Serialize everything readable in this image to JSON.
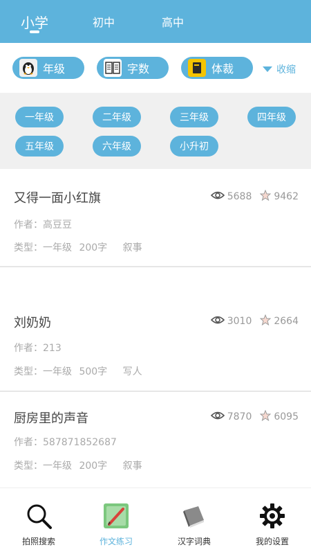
{
  "top_tabs": [
    {
      "label": "小学"
    },
    {
      "label": "初中"
    },
    {
      "label": "高中"
    }
  ],
  "filters": {
    "grade_label": "年级",
    "words_label": "字数",
    "style_label": "体裁",
    "collapse_label": "收缩"
  },
  "grades": [
    "一年级",
    "二年级",
    "三年级",
    "四年级",
    "五年级",
    "六年级",
    "小升初"
  ],
  "articles": [
    {
      "title": "又得一面小红旗",
      "views": "5688",
      "likes": "9462",
      "author": "作者：高豆豆",
      "type_prefix": "类型：一年级",
      "words": "200字",
      "genre": "叙事"
    },
    {
      "title": "刘奶奶",
      "views": "3010",
      "likes": "2664",
      "author": "作者：213",
      "type_prefix": "类型：一年级",
      "words": "500字",
      "genre": "写人"
    },
    {
      "title": "厨房里的声音",
      "views": "7870",
      "likes": "6095",
      "author": "作者：587871852687",
      "type_prefix": "类型：一年级",
      "words": "200字",
      "genre": "叙事"
    }
  ],
  "bottom_nav": [
    {
      "label": "拍照搜索",
      "icon": "magnifier-icon"
    },
    {
      "label": "作文练习",
      "icon": "notebook-pencil-icon"
    },
    {
      "label": "汉字词典",
      "icon": "book-icon"
    },
    {
      "label": "我的设置",
      "icon": "gear-icon"
    }
  ],
  "colors": {
    "accent": "#5db3dc",
    "panel_bg": "#f0f0f0"
  }
}
